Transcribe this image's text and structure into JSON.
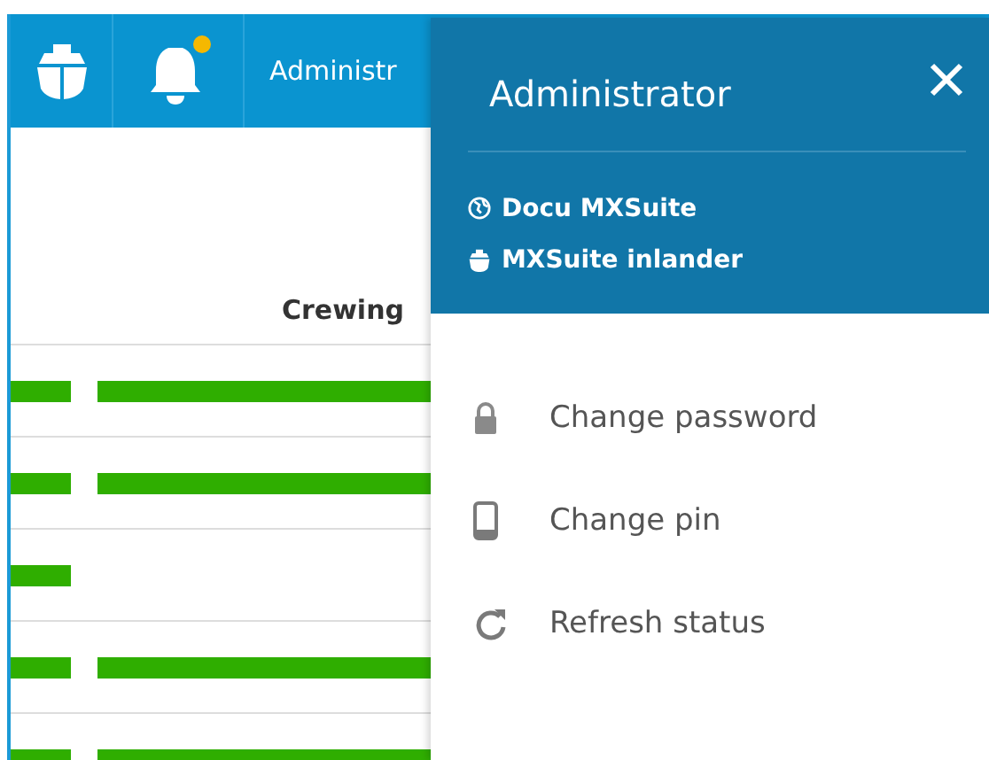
{
  "topbar": {
    "user": "Administr",
    "notification_dot": true
  },
  "table": {
    "columns": [
      "Crewing"
    ],
    "rows": [
      {
        "second_bar": true
      },
      {
        "second_bar": true
      },
      {
        "second_bar": false
      },
      {
        "second_bar": true
      },
      {
        "second_bar": true
      }
    ]
  },
  "user_panel": {
    "title": "Administrator",
    "contexts": [
      {
        "kind": "globe",
        "label": "Docu MXSuite"
      },
      {
        "kind": "ship",
        "label": "MXSuite inlander"
      }
    ],
    "menu": [
      {
        "kind": "lock",
        "label": "Change password"
      },
      {
        "kind": "phone",
        "label": "Change pin"
      },
      {
        "kind": "refresh",
        "label": "Refresh status"
      }
    ]
  }
}
